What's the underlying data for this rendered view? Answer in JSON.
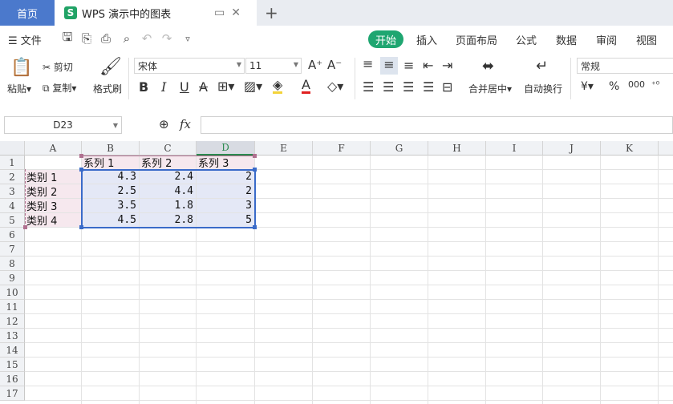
{
  "tabs": {
    "home": "首页",
    "doc_title": "WPS 演示中的图表",
    "add": "+"
  },
  "menu": {
    "file": "文件",
    "tabs": [
      "开始",
      "插入",
      "页面布局",
      "公式",
      "数据",
      "审阅",
      "视图"
    ]
  },
  "ribbon": {
    "paste": "粘贴",
    "cut": "剪切",
    "copy": "复制",
    "format_painter": "格式刷",
    "font_name": "宋体",
    "font_size": "11",
    "merge_center": "合并居中",
    "wrap_text": "自动换行",
    "number_format": "常规",
    "currency": "¥",
    "percent": "%",
    "thousands": "000"
  },
  "formula_bar": {
    "name_box": "D23",
    "fx": "fx",
    "value": ""
  },
  "grid": {
    "columns": [
      "A",
      "B",
      "C",
      "D",
      "E",
      "F",
      "G",
      "H",
      "I",
      "J",
      "K"
    ],
    "rows": [
      "1",
      "2",
      "3",
      "4",
      "5",
      "6",
      "7",
      "8",
      "9",
      "10",
      "11",
      "12",
      "13",
      "14",
      "15",
      "16",
      "17"
    ],
    "headers": [
      "系列 1",
      "系列 2",
      "系列 3"
    ],
    "categories": [
      "类别 1",
      "类别 2",
      "类别 3",
      "类别 4"
    ],
    "values": [
      [
        "4.3",
        "2.4",
        "2"
      ],
      [
        "2.5",
        "4.4",
        "2"
      ],
      [
        "3.5",
        "1.8",
        "3"
      ],
      [
        "4.5",
        "2.8",
        "5"
      ]
    ]
  },
  "colors": {
    "accent": "#1fa671",
    "home_tab": "#4b79cc",
    "selection_border": "#3a6bc9"
  }
}
